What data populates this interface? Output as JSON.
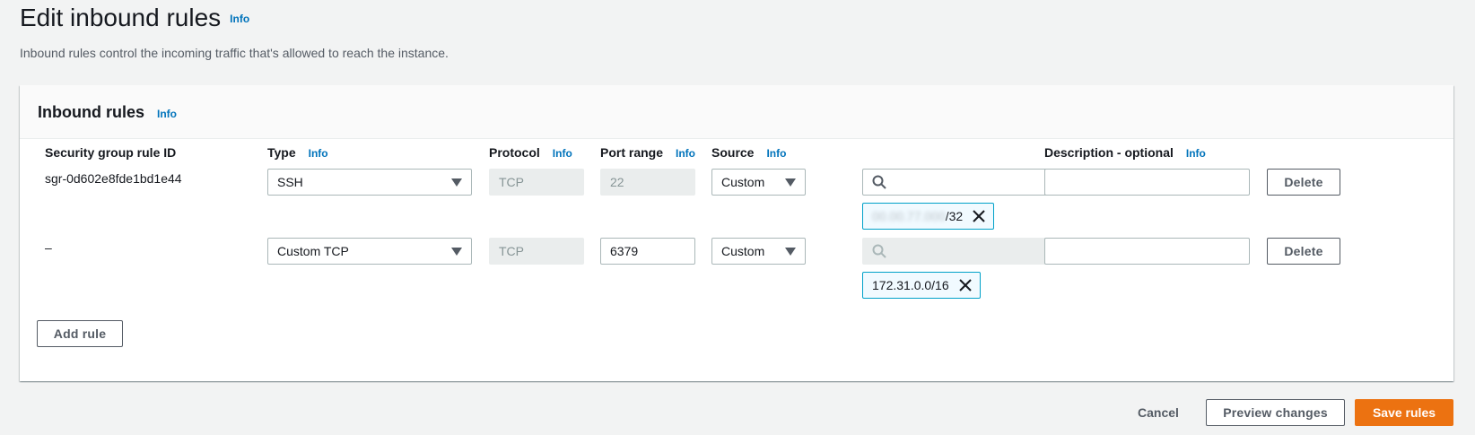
{
  "page": {
    "title": "Edit inbound rules",
    "info": "Info",
    "description": "Inbound rules control the incoming traffic that's allowed to reach the instance."
  },
  "panel": {
    "title": "Inbound rules",
    "info": "Info"
  },
  "columns": {
    "rule_id": "Security group rule ID",
    "type": "Type",
    "protocol": "Protocol",
    "port_range": "Port range",
    "source": "Source",
    "description": "Description - optional",
    "info": "Info"
  },
  "rules": [
    {
      "rule_id": "sgr-0d602e8fde1bd1e44",
      "type": "SSH",
      "protocol": "TCP",
      "port_range": "22",
      "source": "Custom",
      "search_value": "",
      "token_blurred": "00.00.77.000",
      "token_suffix": "/32",
      "description": "",
      "delete": "Delete"
    },
    {
      "rule_id": "–",
      "type": "Custom TCP",
      "protocol": "TCP",
      "port_range": "6379",
      "source": "Custom",
      "search_value": "",
      "token_value": "172.31.0.0/16",
      "description": "",
      "delete": "Delete"
    }
  ],
  "actions": {
    "add_rule": "Add rule",
    "cancel": "Cancel",
    "preview": "Preview changes",
    "save": "Save rules"
  },
  "colors": {
    "primary": "#ec7211",
    "link": "#0073bb",
    "token_border": "#00a1c9"
  },
  "icons": {
    "search": "search-icon",
    "remove": "close-icon",
    "dropdown": "caret-down-icon"
  }
}
